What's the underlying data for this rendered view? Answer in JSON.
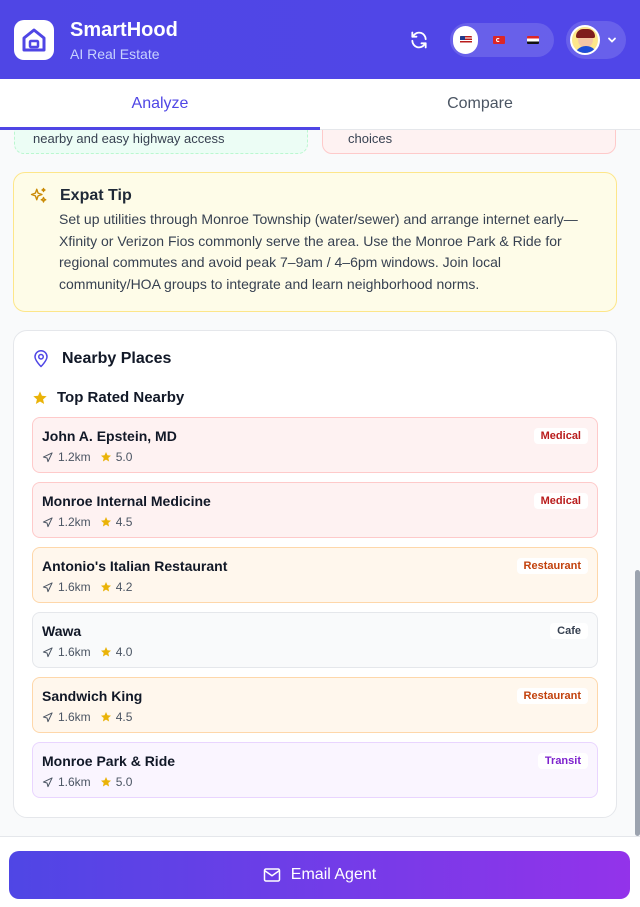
{
  "header": {
    "title": "SmartHood",
    "subtitle": "AI Real Estate",
    "logo_icon": "house-icon",
    "refresh_icon": "refresh-icon",
    "languages": [
      "en-US",
      "tr",
      "ar"
    ],
    "active_language": "en-US"
  },
  "tabs": [
    {
      "label": "Analyze",
      "active": true
    },
    {
      "label": "Compare",
      "active": false
    }
  ],
  "partial_cards": {
    "left_text": "nearby and easy highway access",
    "right_text": "choices"
  },
  "expat_tip": {
    "title": "Expat Tip",
    "icon": "sparkles-icon",
    "text": "Set up utilities through Monroe Township (water/sewer) and arrange internet early—Xfinity or Verizon Fios commonly serve the area. Use the Monroe Park & Ride for regional commutes and avoid peak 7–9am / 4–6pm windows. Join local community/HOA groups to integrate and learn neighborhood norms."
  },
  "nearby": {
    "title": "Nearby Places",
    "top_rated_title": "Top Rated Nearby",
    "places": [
      {
        "name": "John A. Epstein, MD",
        "distance": "1.2km",
        "rating": "5.0",
        "category": "Medical",
        "type": "medical"
      },
      {
        "name": "Monroe Internal Medicine",
        "distance": "1.2km",
        "rating": "4.5",
        "category": "Medical",
        "type": "medical"
      },
      {
        "name": "Antonio's Italian Restaurant",
        "distance": "1.6km",
        "rating": "4.2",
        "category": "Restaurant",
        "type": "restaurant"
      },
      {
        "name": "Wawa",
        "distance": "1.6km",
        "rating": "4.0",
        "category": "Cafe",
        "type": "cafe"
      },
      {
        "name": "Sandwich King",
        "distance": "1.6km",
        "rating": "4.5",
        "category": "Restaurant",
        "type": "restaurant"
      },
      {
        "name": "Monroe Park & Ride",
        "distance": "1.6km",
        "rating": "5.0",
        "category": "Transit",
        "type": "transit"
      }
    ]
  },
  "footer": {
    "email_label": "Email Agent"
  },
  "colors": {
    "primary": "#4f46e5",
    "accent": "#9333ea",
    "star": "#eab308"
  }
}
